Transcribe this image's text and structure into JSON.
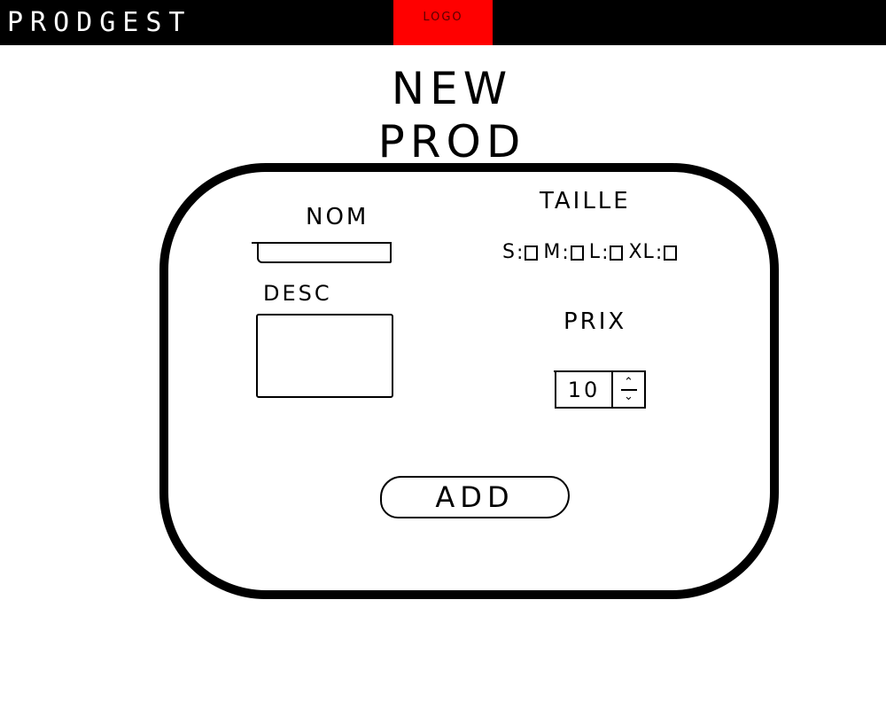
{
  "header": {
    "brand": "PRODGEST",
    "logo": "LOGO"
  },
  "page": {
    "title": "NEW PROD"
  },
  "form": {
    "nom": {
      "label": "NOM",
      "value": ""
    },
    "desc": {
      "label": "DESC",
      "value": ""
    },
    "taille": {
      "label": "TAILLE",
      "options": [
        {
          "code": "S",
          "checked": false
        },
        {
          "code": "M",
          "checked": false
        },
        {
          "code": "L",
          "checked": false
        },
        {
          "code": "XL",
          "checked": false
        }
      ]
    },
    "prix": {
      "label": "PRIX",
      "value": "10",
      "up_icon": "caret-up-icon",
      "down_icon": "caret-down-icon"
    },
    "add_label": "ADD"
  },
  "colors": {
    "topbar": "#000000",
    "logo_bg": "#ff0000",
    "card_border": "#000000"
  }
}
